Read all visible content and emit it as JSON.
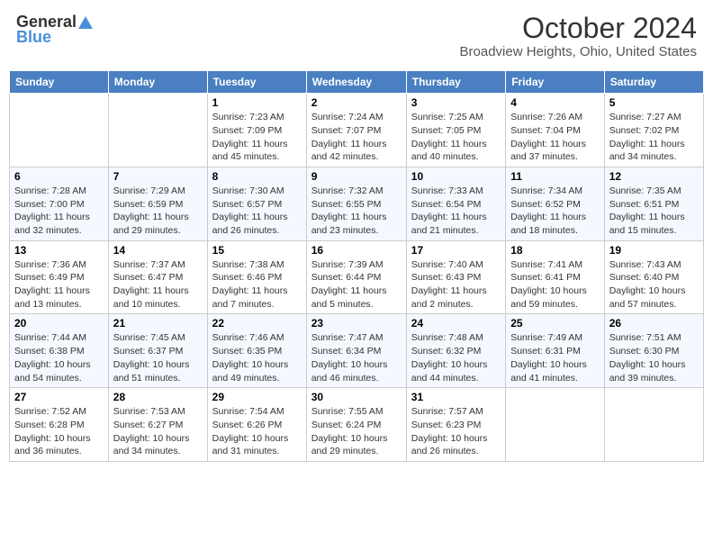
{
  "header": {
    "title": "October 2024",
    "subtitle": "Broadview Heights, Ohio, United States",
    "logo_line1": "General",
    "logo_line2": "Blue"
  },
  "days_of_week": [
    "Sunday",
    "Monday",
    "Tuesday",
    "Wednesday",
    "Thursday",
    "Friday",
    "Saturday"
  ],
  "weeks": [
    [
      {
        "day": "",
        "sunrise": "",
        "sunset": "",
        "daylight": ""
      },
      {
        "day": "",
        "sunrise": "",
        "sunset": "",
        "daylight": ""
      },
      {
        "day": "1",
        "sunrise": "Sunrise: 7:23 AM",
        "sunset": "Sunset: 7:09 PM",
        "daylight": "Daylight: 11 hours and 45 minutes."
      },
      {
        "day": "2",
        "sunrise": "Sunrise: 7:24 AM",
        "sunset": "Sunset: 7:07 PM",
        "daylight": "Daylight: 11 hours and 42 minutes."
      },
      {
        "day": "3",
        "sunrise": "Sunrise: 7:25 AM",
        "sunset": "Sunset: 7:05 PM",
        "daylight": "Daylight: 11 hours and 40 minutes."
      },
      {
        "day": "4",
        "sunrise": "Sunrise: 7:26 AM",
        "sunset": "Sunset: 7:04 PM",
        "daylight": "Daylight: 11 hours and 37 minutes."
      },
      {
        "day": "5",
        "sunrise": "Sunrise: 7:27 AM",
        "sunset": "Sunset: 7:02 PM",
        "daylight": "Daylight: 11 hours and 34 minutes."
      }
    ],
    [
      {
        "day": "6",
        "sunrise": "Sunrise: 7:28 AM",
        "sunset": "Sunset: 7:00 PM",
        "daylight": "Daylight: 11 hours and 32 minutes."
      },
      {
        "day": "7",
        "sunrise": "Sunrise: 7:29 AM",
        "sunset": "Sunset: 6:59 PM",
        "daylight": "Daylight: 11 hours and 29 minutes."
      },
      {
        "day": "8",
        "sunrise": "Sunrise: 7:30 AM",
        "sunset": "Sunset: 6:57 PM",
        "daylight": "Daylight: 11 hours and 26 minutes."
      },
      {
        "day": "9",
        "sunrise": "Sunrise: 7:32 AM",
        "sunset": "Sunset: 6:55 PM",
        "daylight": "Daylight: 11 hours and 23 minutes."
      },
      {
        "day": "10",
        "sunrise": "Sunrise: 7:33 AM",
        "sunset": "Sunset: 6:54 PM",
        "daylight": "Daylight: 11 hours and 21 minutes."
      },
      {
        "day": "11",
        "sunrise": "Sunrise: 7:34 AM",
        "sunset": "Sunset: 6:52 PM",
        "daylight": "Daylight: 11 hours and 18 minutes."
      },
      {
        "day": "12",
        "sunrise": "Sunrise: 7:35 AM",
        "sunset": "Sunset: 6:51 PM",
        "daylight": "Daylight: 11 hours and 15 minutes."
      }
    ],
    [
      {
        "day": "13",
        "sunrise": "Sunrise: 7:36 AM",
        "sunset": "Sunset: 6:49 PM",
        "daylight": "Daylight: 11 hours and 13 minutes."
      },
      {
        "day": "14",
        "sunrise": "Sunrise: 7:37 AM",
        "sunset": "Sunset: 6:47 PM",
        "daylight": "Daylight: 11 hours and 10 minutes."
      },
      {
        "day": "15",
        "sunrise": "Sunrise: 7:38 AM",
        "sunset": "Sunset: 6:46 PM",
        "daylight": "Daylight: 11 hours and 7 minutes."
      },
      {
        "day": "16",
        "sunrise": "Sunrise: 7:39 AM",
        "sunset": "Sunset: 6:44 PM",
        "daylight": "Daylight: 11 hours and 5 minutes."
      },
      {
        "day": "17",
        "sunrise": "Sunrise: 7:40 AM",
        "sunset": "Sunset: 6:43 PM",
        "daylight": "Daylight: 11 hours and 2 minutes."
      },
      {
        "day": "18",
        "sunrise": "Sunrise: 7:41 AM",
        "sunset": "Sunset: 6:41 PM",
        "daylight": "Daylight: 10 hours and 59 minutes."
      },
      {
        "day": "19",
        "sunrise": "Sunrise: 7:43 AM",
        "sunset": "Sunset: 6:40 PM",
        "daylight": "Daylight: 10 hours and 57 minutes."
      }
    ],
    [
      {
        "day": "20",
        "sunrise": "Sunrise: 7:44 AM",
        "sunset": "Sunset: 6:38 PM",
        "daylight": "Daylight: 10 hours and 54 minutes."
      },
      {
        "day": "21",
        "sunrise": "Sunrise: 7:45 AM",
        "sunset": "Sunset: 6:37 PM",
        "daylight": "Daylight: 10 hours and 51 minutes."
      },
      {
        "day": "22",
        "sunrise": "Sunrise: 7:46 AM",
        "sunset": "Sunset: 6:35 PM",
        "daylight": "Daylight: 10 hours and 49 minutes."
      },
      {
        "day": "23",
        "sunrise": "Sunrise: 7:47 AM",
        "sunset": "Sunset: 6:34 PM",
        "daylight": "Daylight: 10 hours and 46 minutes."
      },
      {
        "day": "24",
        "sunrise": "Sunrise: 7:48 AM",
        "sunset": "Sunset: 6:32 PM",
        "daylight": "Daylight: 10 hours and 44 minutes."
      },
      {
        "day": "25",
        "sunrise": "Sunrise: 7:49 AM",
        "sunset": "Sunset: 6:31 PM",
        "daylight": "Daylight: 10 hours and 41 minutes."
      },
      {
        "day": "26",
        "sunrise": "Sunrise: 7:51 AM",
        "sunset": "Sunset: 6:30 PM",
        "daylight": "Daylight: 10 hours and 39 minutes."
      }
    ],
    [
      {
        "day": "27",
        "sunrise": "Sunrise: 7:52 AM",
        "sunset": "Sunset: 6:28 PM",
        "daylight": "Daylight: 10 hours and 36 minutes."
      },
      {
        "day": "28",
        "sunrise": "Sunrise: 7:53 AM",
        "sunset": "Sunset: 6:27 PM",
        "daylight": "Daylight: 10 hours and 34 minutes."
      },
      {
        "day": "29",
        "sunrise": "Sunrise: 7:54 AM",
        "sunset": "Sunset: 6:26 PM",
        "daylight": "Daylight: 10 hours and 31 minutes."
      },
      {
        "day": "30",
        "sunrise": "Sunrise: 7:55 AM",
        "sunset": "Sunset: 6:24 PM",
        "daylight": "Daylight: 10 hours and 29 minutes."
      },
      {
        "day": "31",
        "sunrise": "Sunrise: 7:57 AM",
        "sunset": "Sunset: 6:23 PM",
        "daylight": "Daylight: 10 hours and 26 minutes."
      },
      {
        "day": "",
        "sunrise": "",
        "sunset": "",
        "daylight": ""
      },
      {
        "day": "",
        "sunrise": "",
        "sunset": "",
        "daylight": ""
      }
    ]
  ]
}
